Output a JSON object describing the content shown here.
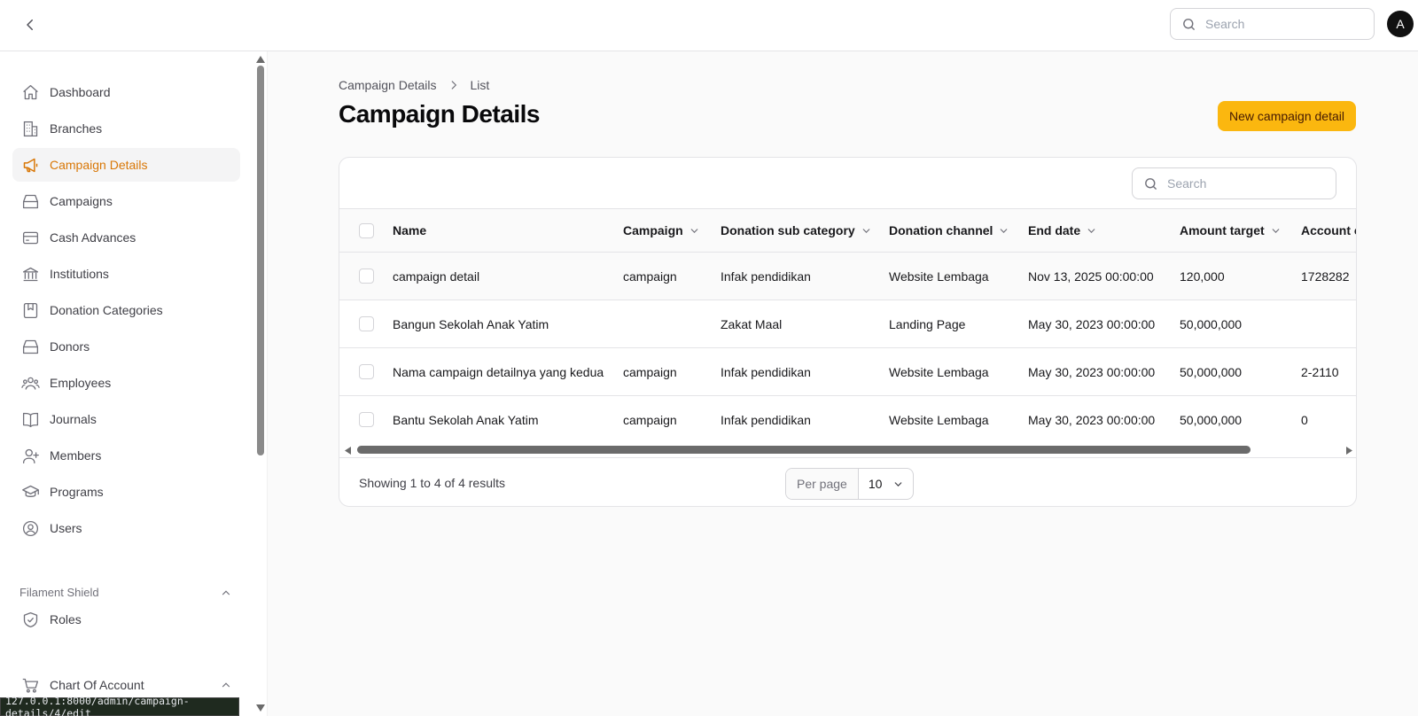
{
  "topbar": {
    "search_placeholder": "Search",
    "avatar_initial": "A"
  },
  "sidebar": {
    "items": [
      {
        "label": "Dashboard",
        "icon": "home-icon"
      },
      {
        "label": "Branches",
        "icon": "building-icon"
      },
      {
        "label": "Campaign Details",
        "icon": "megaphone-icon",
        "active": true
      },
      {
        "label": "Campaigns",
        "icon": "box-icon"
      },
      {
        "label": "Cash Advances",
        "icon": "credit-card-icon"
      },
      {
        "label": "Institutions",
        "icon": "bank-icon"
      },
      {
        "label": "Donation Categories",
        "icon": "bookmark-icon"
      },
      {
        "label": "Donors",
        "icon": "box-icon"
      },
      {
        "label": "Employees",
        "icon": "users-icon"
      },
      {
        "label": "Journals",
        "icon": "book-icon"
      },
      {
        "label": "Members",
        "icon": "user-plus-icon"
      },
      {
        "label": "Programs",
        "icon": "graduation-cap-icon"
      },
      {
        "label": "Users",
        "icon": "user-circle-icon"
      }
    ],
    "groups": [
      {
        "label": "Filament Shield",
        "items": [
          {
            "label": "Roles",
            "icon": "shield-check-icon"
          }
        ]
      },
      {
        "label": "Chart Of Account",
        "icon": "cart-icon"
      }
    ],
    "status_url": "127.0.0.1:8000/admin/campaign-details/4/edit"
  },
  "breadcrumb": {
    "parent": "Campaign Details",
    "current": "List"
  },
  "page": {
    "title": "Campaign Details",
    "new_button": "New campaign detail"
  },
  "table": {
    "search_placeholder": "Search",
    "columns": [
      "Name",
      "Campaign",
      "Donation sub category",
      "Donation channel",
      "End date",
      "Amount target",
      "Account c"
    ],
    "rows": [
      [
        "campaign detail",
        "campaign",
        "Infak pendidikan",
        "Website Lembaga",
        "Nov 13, 2025 00:00:00",
        "120,000",
        "1728282"
      ],
      [
        "Bangun Sekolah Anak Yatim",
        "",
        "Zakat Maal",
        "Landing Page",
        "May 30, 2023 00:00:00",
        "50,000,000",
        ""
      ],
      [
        "Nama campaign detailnya yang kedua",
        "campaign",
        "Infak pendidikan",
        "Website Lembaga",
        "May 30, 2023 00:00:00",
        "50,000,000",
        "2-2110"
      ],
      [
        "Bantu Sekolah Anak Yatim",
        "campaign",
        "Infak pendidikan",
        "Website Lembaga",
        "May 30, 2023 00:00:00",
        "50,000,000",
        "0"
      ]
    ],
    "showing": "Showing 1 to 4 of 4 results",
    "per_page_label": "Per page",
    "per_page_value": "10"
  },
  "colors": {
    "accent": "#d97706",
    "primary_button": "#fbb70f"
  }
}
